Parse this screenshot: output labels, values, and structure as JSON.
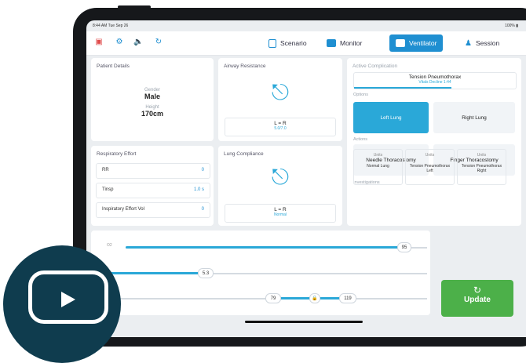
{
  "status": {
    "time": "8:44 AM  Tue Sep 26",
    "battery": "100%"
  },
  "nav": {
    "tabs": [
      {
        "label": "Scenario"
      },
      {
        "label": "Monitor"
      },
      {
        "label": "Ventilator",
        "active": true
      },
      {
        "label": "Session"
      }
    ]
  },
  "patient": {
    "title": "Patient Details",
    "gender_label": "Gender",
    "gender": "Male",
    "height_label": "Height",
    "height": "170cm"
  },
  "airway": {
    "title": "Airway Resistance",
    "value": "L = R",
    "sub": "5.0/7.0"
  },
  "compliance": {
    "title": "Lung Compliance",
    "value": "L = R",
    "sub": "Normal"
  },
  "effort": {
    "title": "Respiratory Effort",
    "rows": [
      {
        "label": "RR",
        "value": "0"
      },
      {
        "label": "Tinsp",
        "value": "1.0 s"
      },
      {
        "label": "Inspiratory Effort Vol",
        "value": "0"
      }
    ]
  },
  "complication": {
    "title": "Active Complication",
    "name": "Tension Pneumothorax",
    "sub": "Vitals Decline  1:44",
    "options_label": "Options",
    "options": [
      {
        "label": "Left Lung",
        "active": true
      },
      {
        "label": "Right Lung",
        "active": false
      }
    ],
    "actions_label": "Actions",
    "actions": [
      "Needle Thoracostomy",
      "Finger Thoracostomy"
    ],
    "investigations_label": "Investigations",
    "investigations": [
      {
        "unit": "Units",
        "name": "Normal Lung"
      },
      {
        "unit": "Units",
        "name": "Tension Pneumothorax Left"
      },
      {
        "unit": "Units",
        "name": "Tension Pneumothorax Right"
      }
    ]
  },
  "sliders": [
    {
      "label": "O2",
      "value": "95"
    },
    {
      "label": "",
      "value": "5.3"
    },
    {
      "label": "",
      "low": "79",
      "high": "119"
    }
  ],
  "update": {
    "label": "Update"
  },
  "colors": {
    "accent": "#1f8fd1",
    "update": "#4cb049",
    "overlay": "#0f3c4e"
  }
}
